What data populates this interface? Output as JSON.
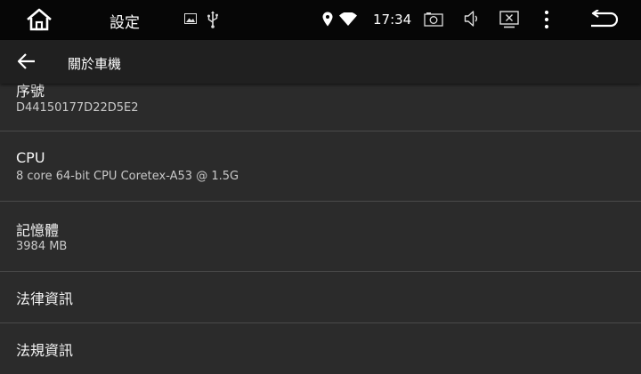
{
  "statusbar": {
    "title": "設定",
    "time": "17:34",
    "icons": [
      "home-icon",
      "image-icon",
      "usb-icon",
      "location-icon",
      "wifi-icon",
      "camera-icon",
      "volume-icon",
      "screenshot-icon",
      "more-vert-icon",
      "back-icon"
    ]
  },
  "appbar": {
    "title": "關於車機",
    "back_icon": "arrow-back-icon"
  },
  "items": [
    {
      "title": "序號",
      "summary": "D44150177D22D5E2"
    },
    {
      "title": "CPU",
      "summary": "8 core 64-bit CPU Coretex-A53 @ 1.5G"
    },
    {
      "title": "記憶體",
      "summary": "3984 MB"
    },
    {
      "title": "法律資訊"
    },
    {
      "title": "法規資訊"
    }
  ],
  "colors": {
    "statusbar_bg": "#060606",
    "appbar_bg": "#202020",
    "background": "#2b2b2b",
    "divider": "#4a4a4a"
  }
}
